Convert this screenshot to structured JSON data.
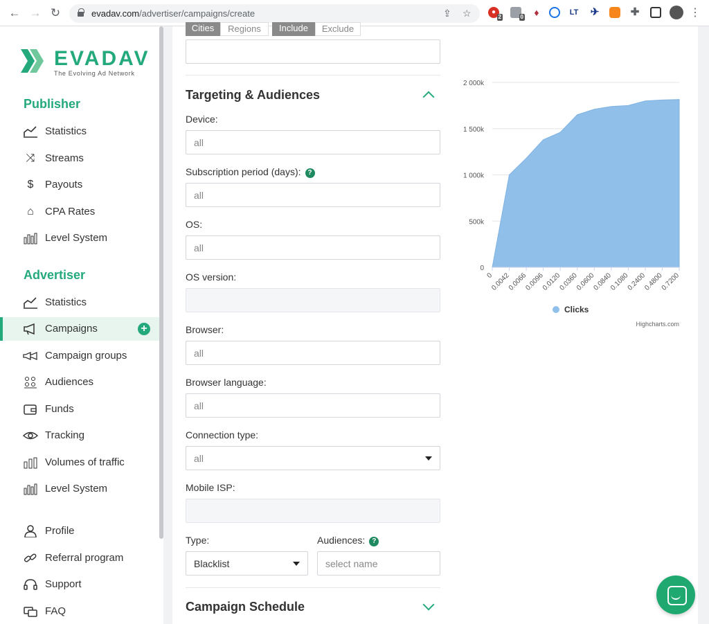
{
  "browser": {
    "url_host": "evadav.com",
    "url_path": "/advertiser/campaigns/create",
    "ext_badges": [
      "2",
      "0"
    ],
    "ext_text": "LT"
  },
  "logo": {
    "name": "EVADAV",
    "tagline": "The Evolving Ad Network"
  },
  "sidebar": {
    "publisher_title": "Publisher",
    "publisher_items": [
      {
        "label": "Statistics",
        "icon": "statistics-icon"
      },
      {
        "label": "Streams",
        "icon": "shuffle-icon"
      },
      {
        "label": "Payouts",
        "icon": "payouts-icon"
      },
      {
        "label": "CPA Rates",
        "icon": "tag-icon"
      },
      {
        "label": "Level System",
        "icon": "bars-icon"
      }
    ],
    "advertiser_title": "Advertiser",
    "advertiser_items": [
      {
        "label": "Statistics",
        "icon": "statistics-icon"
      },
      {
        "label": "Campaigns",
        "icon": "megaphone-icon"
      },
      {
        "label": "Campaign groups",
        "icon": "megaphones-icon"
      },
      {
        "label": "Audiences",
        "icon": "audiences-icon"
      },
      {
        "label": "Funds",
        "icon": "wallet-icon"
      },
      {
        "label": "Tracking",
        "icon": "eye-icon"
      },
      {
        "label": "Volumes of traffic",
        "icon": "bars-icon"
      },
      {
        "label": "Level System",
        "icon": "bars-icon"
      }
    ],
    "account_items": [
      {
        "label": "Profile",
        "icon": "user-icon"
      },
      {
        "label": "Referral program",
        "icon": "link-icon"
      },
      {
        "label": "Support",
        "icon": "headset-icon"
      },
      {
        "label": "FAQ",
        "icon": "faq-icon"
      }
    ]
  },
  "geo": {
    "tab_cities": "Cities",
    "tab_regions": "Regions",
    "tab_include": "Include",
    "tab_exclude": "Exclude"
  },
  "targeting": {
    "title": "Targeting & Audiences",
    "device_label": "Device:",
    "device_value": "all",
    "subscription_label": "Subscription period (days):",
    "subscription_value": "all",
    "os_label": "OS:",
    "os_value": "all",
    "os_version_label": "OS version:",
    "browser_label": "Browser:",
    "browser_value": "all",
    "browser_lang_label": "Browser language:",
    "browser_lang_value": "all",
    "connection_label": "Connection type:",
    "connection_value": "all",
    "isp_label": "Mobile ISP:",
    "type_label": "Type:",
    "type_value": "Blacklist",
    "audiences_label": "Audiences:",
    "audiences_placeholder": "select name",
    "help_glyph": "?"
  },
  "schedule": {
    "title": "Campaign Schedule"
  },
  "chart_data": {
    "type": "area",
    "categories": [
      "0",
      "0.0042",
      "0.0066",
      "0.0096",
      "0.0120",
      "0.0360",
      "0.0600",
      "0.0840",
      "0.1080",
      "0.2400",
      "0.4800",
      "0.7200"
    ],
    "series": [
      {
        "name": "Clicks",
        "values": [
          0,
          1000000,
          1180000,
          1380000,
          1460000,
          1650000,
          1710000,
          1740000,
          1750000,
          1800000,
          1810000,
          1815000
        ]
      }
    ],
    "yticks": [
      "0",
      "500k",
      "1 000k",
      "1 500k",
      "2 000k"
    ],
    "ylim": [
      0,
      2000000
    ],
    "color": "#90bfea",
    "credit": "Highcharts.com",
    "legend": "bottom-center"
  }
}
